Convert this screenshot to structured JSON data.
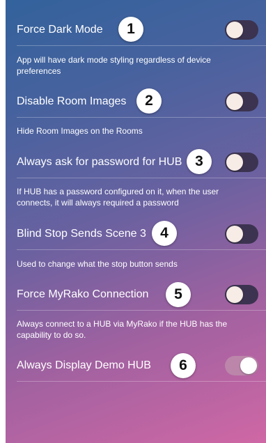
{
  "settings": [
    {
      "label": "Force Dark Mode",
      "description": "App will have dark mode styling regardless of device preferences",
      "badge": "1",
      "enabled": false
    },
    {
      "label": "Disable Room Images",
      "description": "Hide Room Images on the Rooms",
      "badge": "2",
      "enabled": false
    },
    {
      "label": "Always ask for password for HUB",
      "description": "If HUB has a password configured on it, when the user connects, it will always required a password",
      "badge": "3",
      "enabled": false
    },
    {
      "label": "Blind Stop Sends Scene 3",
      "description": "Used to change what the stop button sends",
      "badge": "4",
      "enabled": false
    },
    {
      "label": "Force MyRako Connection",
      "description": "Always connect to a HUB via MyRako if the HUB has the capability to do so.",
      "badge": "5",
      "enabled": false
    },
    {
      "label": "Always Display Demo HUB",
      "description": "",
      "badge": "6",
      "enabled": true
    }
  ]
}
